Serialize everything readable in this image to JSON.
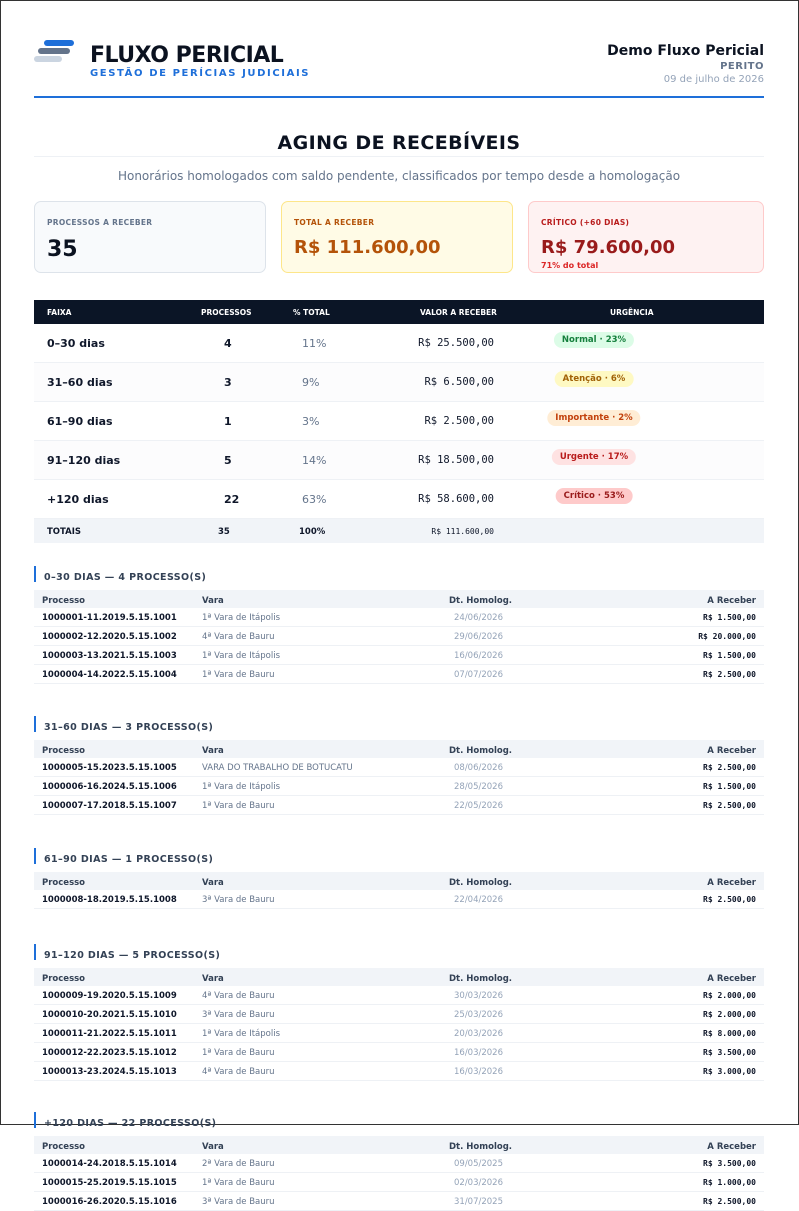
{
  "header": {
    "brand": "FLUXO PERICIAL",
    "brand_sub": "GESTÃO DE PERÍCIAS JUDICIAIS",
    "user": "Demo Fluxo Pericial",
    "role": "PERITO",
    "date": "09 de julho de 2026",
    "logo_colors": [
      "#1e6fd9",
      "#64748b",
      "#cbd5e1"
    ]
  },
  "title": "AGING DE RECEBÍVEIS",
  "subtitle": "Honorários homologados com saldo pendente, classificados por tempo desde a homologação",
  "cards": [
    {
      "label": "PROCESSOS A RECEBER",
      "value": "35",
      "note": ""
    },
    {
      "label": "TOTAL A RECEBER",
      "value": "R$ 111.600,00",
      "note": ""
    },
    {
      "label": "CRÍTICO (+60 DIAS)",
      "value": "R$ 79.600,00",
      "note": "71% do total"
    }
  ],
  "aging": {
    "headers": [
      "FAIXA",
      "PROCESSOS",
      "% TOTAL",
      "VALOR A RECEBER",
      "URGÊNCIA"
    ],
    "rows": [
      {
        "faixa": "0–30 dias",
        "processos": "4",
        "pct": "11%",
        "valor": "R$ 25.500,00",
        "urgencia": "Normal · 23%",
        "bg": "#dcfce7",
        "fg": "#15803d"
      },
      {
        "faixa": "31–60 dias",
        "processos": "3",
        "pct": "9%",
        "valor": "R$ 6.500,00",
        "urgencia": "Atenção · 6%",
        "bg": "#fef9c3",
        "fg": "#a16207"
      },
      {
        "faixa": "61–90 dias",
        "processos": "1",
        "pct": "3%",
        "valor": "R$ 2.500,00",
        "urgencia": "Importante · 2%",
        "bg": "#ffedd5",
        "fg": "#c2410c"
      },
      {
        "faixa": "91–120 dias",
        "processos": "5",
        "pct": "14%",
        "valor": "R$ 18.500,00",
        "urgencia": "Urgente · 17%",
        "bg": "#fee2e2",
        "fg": "#b91c1c"
      },
      {
        "faixa": "+120 dias",
        "processos": "22",
        "pct": "63%",
        "valor": "R$ 58.600,00",
        "urgencia": "Crítico · 53%",
        "bg": "#fecaca",
        "fg": "#991b1b"
      }
    ],
    "totals": {
      "label": "TOTAIS",
      "processos": "35",
      "pct": "100%",
      "valor": "R$ 111.600,00"
    }
  },
  "detail_headers": [
    "Processo",
    "Vara",
    "Dt. Homolog.",
    "A Receber"
  ],
  "sections": [
    {
      "title": "0–30 DIAS — 4 PROCESSO(S)",
      "rows": [
        [
          "1000001-11.2019.5.15.1001",
          "1ª Vara de Itápolis",
          "24/06/2026",
          "R$ 1.500,00"
        ],
        [
          "1000002-12.2020.5.15.1002",
          "4ª Vara de Bauru",
          "29/06/2026",
          "R$ 20.000,00"
        ],
        [
          "1000003-13.2021.5.15.1003",
          "1ª Vara de Itápolis",
          "16/06/2026",
          "R$ 1.500,00"
        ],
        [
          "1000004-14.2022.5.15.1004",
          "1ª Vara de Bauru",
          "07/07/2026",
          "R$ 2.500,00"
        ]
      ]
    },
    {
      "title": "31–60 DIAS — 3 PROCESSO(S)",
      "rows": [
        [
          "1000005-15.2023.5.15.1005",
          "VARA DO TRABALHO DE BOTUCATU",
          "08/06/2026",
          "R$ 2.500,00"
        ],
        [
          "1000006-16.2024.5.15.1006",
          "1ª Vara de Itápolis",
          "28/05/2026",
          "R$ 1.500,00"
        ],
        [
          "1000007-17.2018.5.15.1007",
          "1ª Vara de Bauru",
          "22/05/2026",
          "R$ 2.500,00"
        ]
      ]
    },
    {
      "title": "61–90 DIAS — 1 PROCESSO(S)",
      "rows": [
        [
          "1000008-18.2019.5.15.1008",
          "3ª Vara de Bauru",
          "22/04/2026",
          "R$ 2.500,00"
        ]
      ]
    },
    {
      "title": "91–120 DIAS — 5 PROCESSO(S)",
      "rows": [
        [
          "1000009-19.2020.5.15.1009",
          "4ª Vara de Bauru",
          "30/03/2026",
          "R$ 2.000,00"
        ],
        [
          "1000010-20.2021.5.15.1010",
          "3ª Vara de Bauru",
          "25/03/2026",
          "R$ 2.000,00"
        ],
        [
          "1000011-21.2022.5.15.1011",
          "1ª Vara de Itápolis",
          "20/03/2026",
          "R$ 8.000,00"
        ],
        [
          "1000012-22.2023.5.15.1012",
          "1ª Vara de Bauru",
          "16/03/2026",
          "R$ 3.500,00"
        ],
        [
          "1000013-23.2024.5.15.1013",
          "4ª Vara de Bauru",
          "16/03/2026",
          "R$ 3.000,00"
        ]
      ]
    },
    {
      "title": "+120 DIAS — 22 PROCESSO(S)",
      "rows": [
        [
          "1000014-24.2018.5.15.1014",
          "2ª Vara de Bauru",
          "09/05/2025",
          "R$ 3.500,00"
        ],
        [
          "1000015-25.2019.5.15.1015",
          "1ª Vara de Bauru",
          "02/03/2026",
          "R$ 1.000,00"
        ],
        [
          "1000016-26.2020.5.15.1016",
          "3ª Vara de Bauru",
          "31/07/2025",
          "R$ 2.500,00"
        ]
      ]
    }
  ]
}
